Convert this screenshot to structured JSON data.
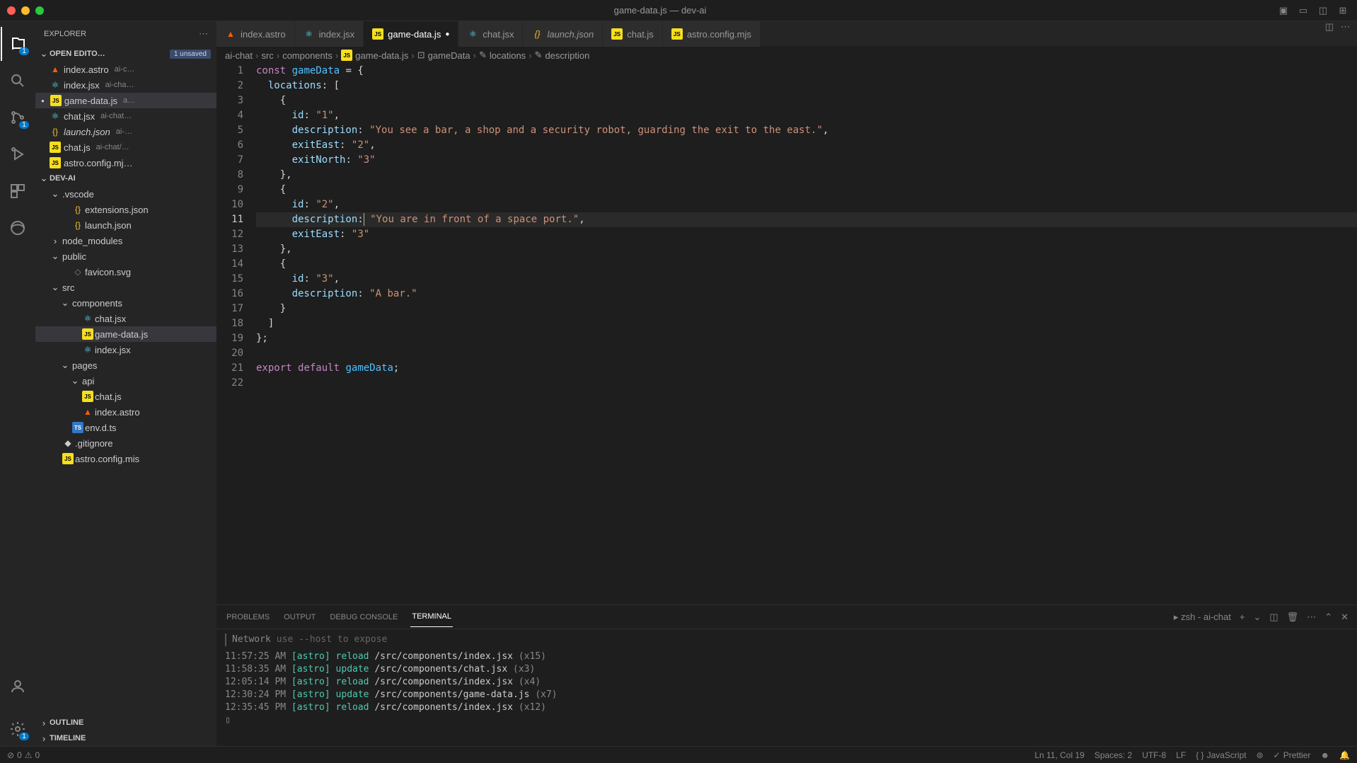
{
  "window": {
    "title": "game-data.js — dev-ai"
  },
  "activity": {
    "explorer_badge": "1",
    "scm_badge": "1"
  },
  "sidebar": {
    "title": "EXPLORER",
    "open_editors": {
      "label": "OPEN EDITO…",
      "unsaved": "1 unsaved",
      "items": [
        {
          "name": "index.astro",
          "path": "ai-c…",
          "type": "astro"
        },
        {
          "name": "index.jsx",
          "path": "ai-cha…",
          "type": "jsx"
        },
        {
          "name": "game-data.js",
          "path": "a…",
          "type": "js",
          "selected": true,
          "modified": true
        },
        {
          "name": "chat.jsx",
          "path": "ai-chat…",
          "type": "jsx"
        },
        {
          "name": "launch.json",
          "path": "ai-…",
          "type": "json",
          "italic": true
        },
        {
          "name": "chat.js",
          "path": "ai-chat/…",
          "type": "js"
        },
        {
          "name": "astro.config.mj…",
          "path": "",
          "type": "js"
        }
      ]
    },
    "folder_label": "DEV-AI",
    "tree": [
      {
        "name": ".vscode",
        "indent": 1,
        "folder": true,
        "open": true
      },
      {
        "name": "extensions.json",
        "indent": 2,
        "type": "json"
      },
      {
        "name": "launch.json",
        "indent": 2,
        "type": "json"
      },
      {
        "name": "node_modules",
        "indent": 1,
        "folder": true
      },
      {
        "name": "public",
        "indent": 1,
        "folder": true,
        "open": true
      },
      {
        "name": "favicon.svg",
        "indent": 2,
        "type": "svg"
      },
      {
        "name": "src",
        "indent": 1,
        "folder": true,
        "open": true
      },
      {
        "name": "components",
        "indent": 2,
        "folder": true,
        "open": true
      },
      {
        "name": "chat.jsx",
        "indent": 3,
        "type": "jsx"
      },
      {
        "name": "game-data.js",
        "indent": 3,
        "type": "js",
        "selected": true
      },
      {
        "name": "index.jsx",
        "indent": 3,
        "type": "jsx"
      },
      {
        "name": "pages",
        "indent": 2,
        "folder": true,
        "open": true
      },
      {
        "name": "api",
        "indent": 3,
        "folder": true,
        "open": true
      },
      {
        "name": "chat.js",
        "indent": 3,
        "type": "js"
      },
      {
        "name": "index.astro",
        "indent": 3,
        "type": "astro"
      },
      {
        "name": "env.d.ts",
        "indent": 2,
        "type": "ts"
      },
      {
        "name": ".gitignore",
        "indent": 1,
        "type": "file"
      },
      {
        "name": "astro.config.mis",
        "indent": 1,
        "type": "js"
      }
    ],
    "outline": "OUTLINE",
    "timeline": "TIMELINE"
  },
  "tabs": [
    {
      "name": "index.astro",
      "type": "astro"
    },
    {
      "name": "index.jsx",
      "type": "jsx"
    },
    {
      "name": "game-data.js",
      "type": "js",
      "active": true,
      "modified": true
    },
    {
      "name": "chat.jsx",
      "type": "jsx"
    },
    {
      "name": "launch.json",
      "type": "json",
      "italic": true
    },
    {
      "name": "chat.js",
      "type": "js"
    },
    {
      "name": "astro.config.mjs",
      "type": "js"
    }
  ],
  "breadcrumb": [
    "ai-chat",
    "src",
    "components",
    "game-data.js",
    "gameData",
    "locations",
    "description"
  ],
  "code": {
    "lines": [
      {
        "n": 1,
        "html": "<span class='kw'>const</span> <span class='var'>gameData</span> <span class='punct'>=</span> <span class='punct'>{</span>"
      },
      {
        "n": 2,
        "html": "  <span class='prop'>locations</span><span class='punct'>:</span> <span class='punct'>[</span>"
      },
      {
        "n": 3,
        "html": "    <span class='punct'>{</span>"
      },
      {
        "n": 4,
        "html": "      <span class='prop'>id</span><span class='punct'>:</span> <span class='str'>\"1\"</span><span class='punct'>,</span>"
      },
      {
        "n": 5,
        "html": "      <span class='prop'>description</span><span class='punct'>:</span> <span class='str'>\"You see a bar, a shop and a security robot, guarding the exit to the east.\"</span><span class='punct'>,</span>"
      },
      {
        "n": 6,
        "html": "      <span class='prop'>exitEast</span><span class='punct'>:</span> <span class='str'>\"2\"</span><span class='punct'>,</span>"
      },
      {
        "n": 7,
        "html": "      <span class='prop'>exitNorth</span><span class='punct'>:</span> <span class='str'>\"3\"</span>"
      },
      {
        "n": 8,
        "html": "    <span class='punct'>},</span>"
      },
      {
        "n": 9,
        "html": "    <span class='punct'>{</span>"
      },
      {
        "n": 10,
        "html": "      <span class='prop'>id</span><span class='punct'>:</span> <span class='str'>\"2\"</span><span class='punct'>,</span>"
      },
      {
        "n": 11,
        "current": true,
        "html": "      <span class='prop'>description</span><span class='punct'>:</span><span class='cursor'></span> <span class='str'>\"You are in front of a space port.\"</span><span class='punct'>,</span>"
      },
      {
        "n": 12,
        "html": "      <span class='prop'>exitEast</span><span class='punct'>:</span> <span class='str'>\"3\"</span>"
      },
      {
        "n": 13,
        "html": "    <span class='punct'>},</span>"
      },
      {
        "n": 14,
        "html": "    <span class='punct'>{</span>"
      },
      {
        "n": 15,
        "html": "      <span class='prop'>id</span><span class='punct'>:</span> <span class='str'>\"3\"</span><span class='punct'>,</span>"
      },
      {
        "n": 16,
        "html": "      <span class='prop'>description</span><span class='punct'>:</span> <span class='str'>\"A bar.\"</span>"
      },
      {
        "n": 17,
        "html": "    <span class='punct'>}</span>"
      },
      {
        "n": 18,
        "html": "  <span class='punct'>]</span>"
      },
      {
        "n": 19,
        "html": "<span class='punct'>};</span>"
      },
      {
        "n": 20,
        "html": ""
      },
      {
        "n": 21,
        "html": "<span class='kw'>export</span> <span class='kw'>default</span> <span class='var'>gameData</span><span class='punct'>;</span>"
      },
      {
        "n": 22,
        "html": ""
      }
    ]
  },
  "panel": {
    "tabs": {
      "problems": "PROBLEMS",
      "output": "OUTPUT",
      "debug": "DEBUG CONSOLE",
      "terminal": "TERMINAL"
    },
    "terminal_label": "zsh - ai-chat",
    "network_label": "Network",
    "network_hint": "use --host to expose",
    "lines": [
      {
        "time": "11:57:25 AM",
        "tag": "[astro]",
        "action": "reload",
        "path": "/src/components/index.jsx",
        "count": "(x15)"
      },
      {
        "time": "11:58:35 AM",
        "tag": "[astro]",
        "action": "update",
        "path": "/src/components/chat.jsx",
        "count": "(x3)"
      },
      {
        "time": "12:05:14 PM",
        "tag": "[astro]",
        "action": "reload",
        "path": "/src/components/index.jsx",
        "count": "(x4)"
      },
      {
        "time": "12:30:24 PM",
        "tag": "[astro]",
        "action": "update",
        "path": "/src/components/game-data.js",
        "count": "(x7)"
      },
      {
        "time": "12:35:45 PM",
        "tag": "[astro]",
        "action": "reload",
        "path": "/src/components/index.jsx",
        "count": "(x12)"
      }
    ]
  },
  "status": {
    "errors": "0",
    "warnings": "0",
    "position": "Ln 11, Col 19",
    "spaces": "Spaces: 2",
    "encoding": "UTF-8",
    "eol": "LF",
    "language": "JavaScript",
    "prettier": "Prettier"
  }
}
